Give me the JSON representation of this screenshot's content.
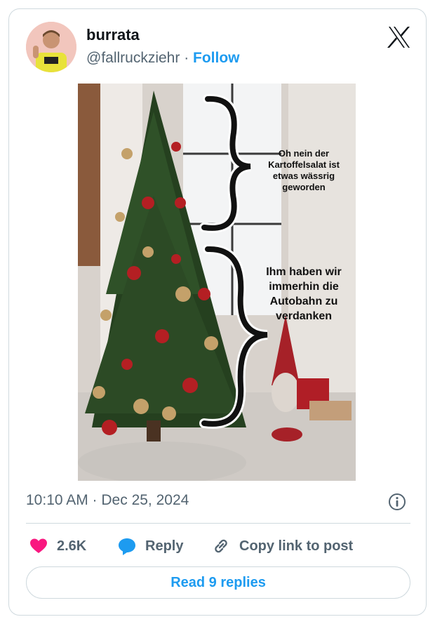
{
  "tweet": {
    "author_name": "burrata",
    "author_handle": "@fallruckziehr",
    "separator": " · ",
    "follow_label": "Follow",
    "timestamp": "10:10 AM · Dec 25, 2024",
    "image": {
      "caption_top": "Oh nein der Kartoffelsalat ist etwas wässrig geworden",
      "caption_bottom": "Ihm haben wir immerhin die Autobahn zu verdanken"
    }
  },
  "actions": {
    "likes_count": "2.6K",
    "reply_label": "Reply",
    "copy_link_label": "Copy link to post"
  },
  "footer": {
    "read_replies_label": "Read 9 replies"
  },
  "colors": {
    "accent": "#1d9bf0",
    "like": "#f91880",
    "text_secondary": "#536471",
    "border": "#cfd9de"
  },
  "icons": [
    "x-logo-icon",
    "info-icon",
    "heart-icon",
    "reply-bubble-icon",
    "link-icon"
  ]
}
